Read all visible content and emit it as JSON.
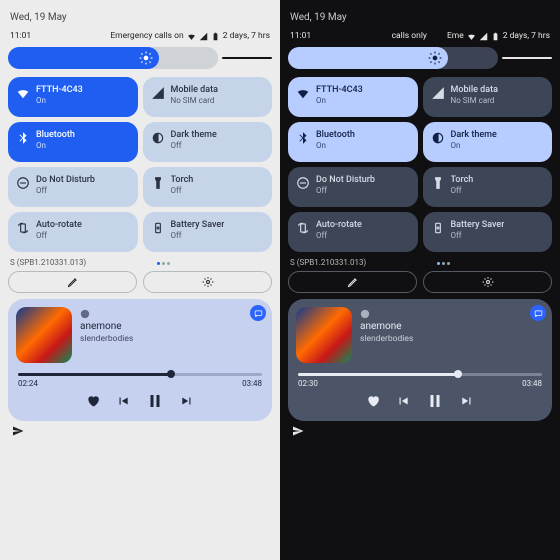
{
  "date": "Wed, 19 May",
  "light": {
    "time": "11:01",
    "status_text": "Emergency calls on",
    "battery_text": "2 days, 7 hrs",
    "tiles": [
      {
        "name": "FTTH-4C43",
        "state": "On"
      },
      {
        "name": "Mobile data",
        "state": "No SIM card"
      },
      {
        "name": "Bluetooth",
        "state": "On"
      },
      {
        "name": "Dark theme",
        "state": "Off"
      },
      {
        "name": "Do Not Disturb",
        "state": "Off"
      },
      {
        "name": "Torch",
        "state": "Off"
      },
      {
        "name": "Auto-rotate",
        "state": "Off"
      },
      {
        "name": "Battery Saver",
        "state": "Off"
      }
    ],
    "build": "S (SPB1.210331.013)",
    "media": {
      "title": "anemone",
      "artist": "slenderbodies",
      "elapsed": "02:24",
      "total": "03:48",
      "progress": 0.63
    }
  },
  "dark": {
    "time": "11:01",
    "status_text_a": "calls only",
    "status_text_b": "Eme",
    "battery_text": "2 days, 7 hrs",
    "tiles": [
      {
        "name": "FTTH-4C43",
        "state": "On"
      },
      {
        "name": "Mobile data",
        "state": "No SIM card"
      },
      {
        "name": "Bluetooth",
        "state": "On"
      },
      {
        "name": "Dark theme",
        "state": "On"
      },
      {
        "name": "Do Not Disturb",
        "state": "Off"
      },
      {
        "name": "Torch",
        "state": "Off"
      },
      {
        "name": "Auto-rotate",
        "state": "Off"
      },
      {
        "name": "Battery Saver",
        "state": "Off"
      }
    ],
    "build": "S (SPB1.210331.013)",
    "media": {
      "title": "anemone",
      "artist": "slenderbodies",
      "elapsed": "02:30",
      "total": "03:48",
      "progress": 0.66
    }
  }
}
